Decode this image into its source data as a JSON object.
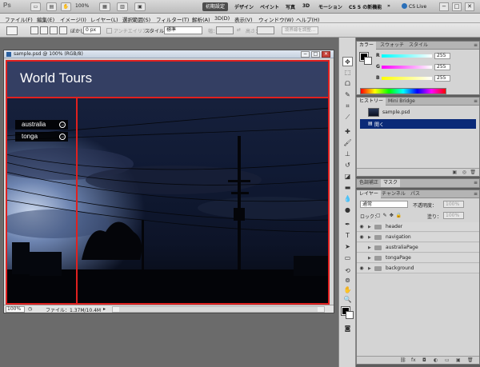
{
  "appbar": {
    "logo": "Ps",
    "zoom": "100%",
    "workspaces": {
      "active": "初期設定",
      "items": [
        "デザイン",
        "ペイント",
        "写真",
        "3D",
        "モーション",
        "CS 5 の新機能"
      ],
      "more": "»"
    },
    "cs_live": "CS Live",
    "window_controls": [
      "−",
      "□",
      "✕"
    ]
  },
  "menubar": {
    "items": [
      "ファイル(F)",
      "編集(E)",
      "イメージ(I)",
      "レイヤー(L)",
      "選択範囲(S)",
      "フィルター(T)",
      "解析(A)",
      "3D(D)",
      "表示(V)",
      "ウィンドウ(W)",
      "ヘルプ(H)"
    ]
  },
  "optbar": {
    "feather_label": "ぼかし：",
    "feather_value": "0 px",
    "antialias_label": "アンチエイリアス",
    "style_label": "スタイル：",
    "style_value": "標準",
    "width_label": "幅：",
    "height_label": "高さ：",
    "refine_edge": "境界線を調整..."
  },
  "document": {
    "title": "sample.psd @ 100% (RGB/8)",
    "site_title": "World Tours",
    "nav": [
      "australia",
      "tonga"
    ],
    "zoom": "100%",
    "file_info": "ファイル：1.37M/10.4M"
  },
  "panels": {
    "color": {
      "tabs": [
        "カラー",
        "スウォッチ",
        "スタイル"
      ],
      "channels": [
        {
          "label": "R",
          "value": "255",
          "color": "#ff3a3a"
        },
        {
          "label": "G",
          "value": "255",
          "color": "#3ad43a"
        },
        {
          "label": "B",
          "value": "255",
          "color": "#3a5aff"
        }
      ]
    },
    "history": {
      "tabs": [
        "ヒストリー",
        "Mini Bridge"
      ],
      "snapshot": "sample.psd",
      "states": [
        "開く"
      ]
    },
    "adjust": {
      "tabs": [
        "色調補正",
        "マスク"
      ]
    },
    "layers": {
      "tabs": [
        "レイヤー",
        "チャンネル",
        "パス"
      ],
      "blend_mode": "通常",
      "opacity_label": "不透明度：",
      "opacity_value": "100%",
      "lock_label": "ロック：",
      "fill_label": "塗り：",
      "fill_value": "100%",
      "items": [
        {
          "name": "header",
          "visible": true,
          "nested": false
        },
        {
          "name": "navigation",
          "visible": true,
          "nested": false
        },
        {
          "name": "australiaPage",
          "visible": false,
          "nested": false
        },
        {
          "name": "tongaPage",
          "visible": false,
          "nested": false
        },
        {
          "name": "background",
          "visible": true,
          "nested": false
        }
      ]
    }
  }
}
